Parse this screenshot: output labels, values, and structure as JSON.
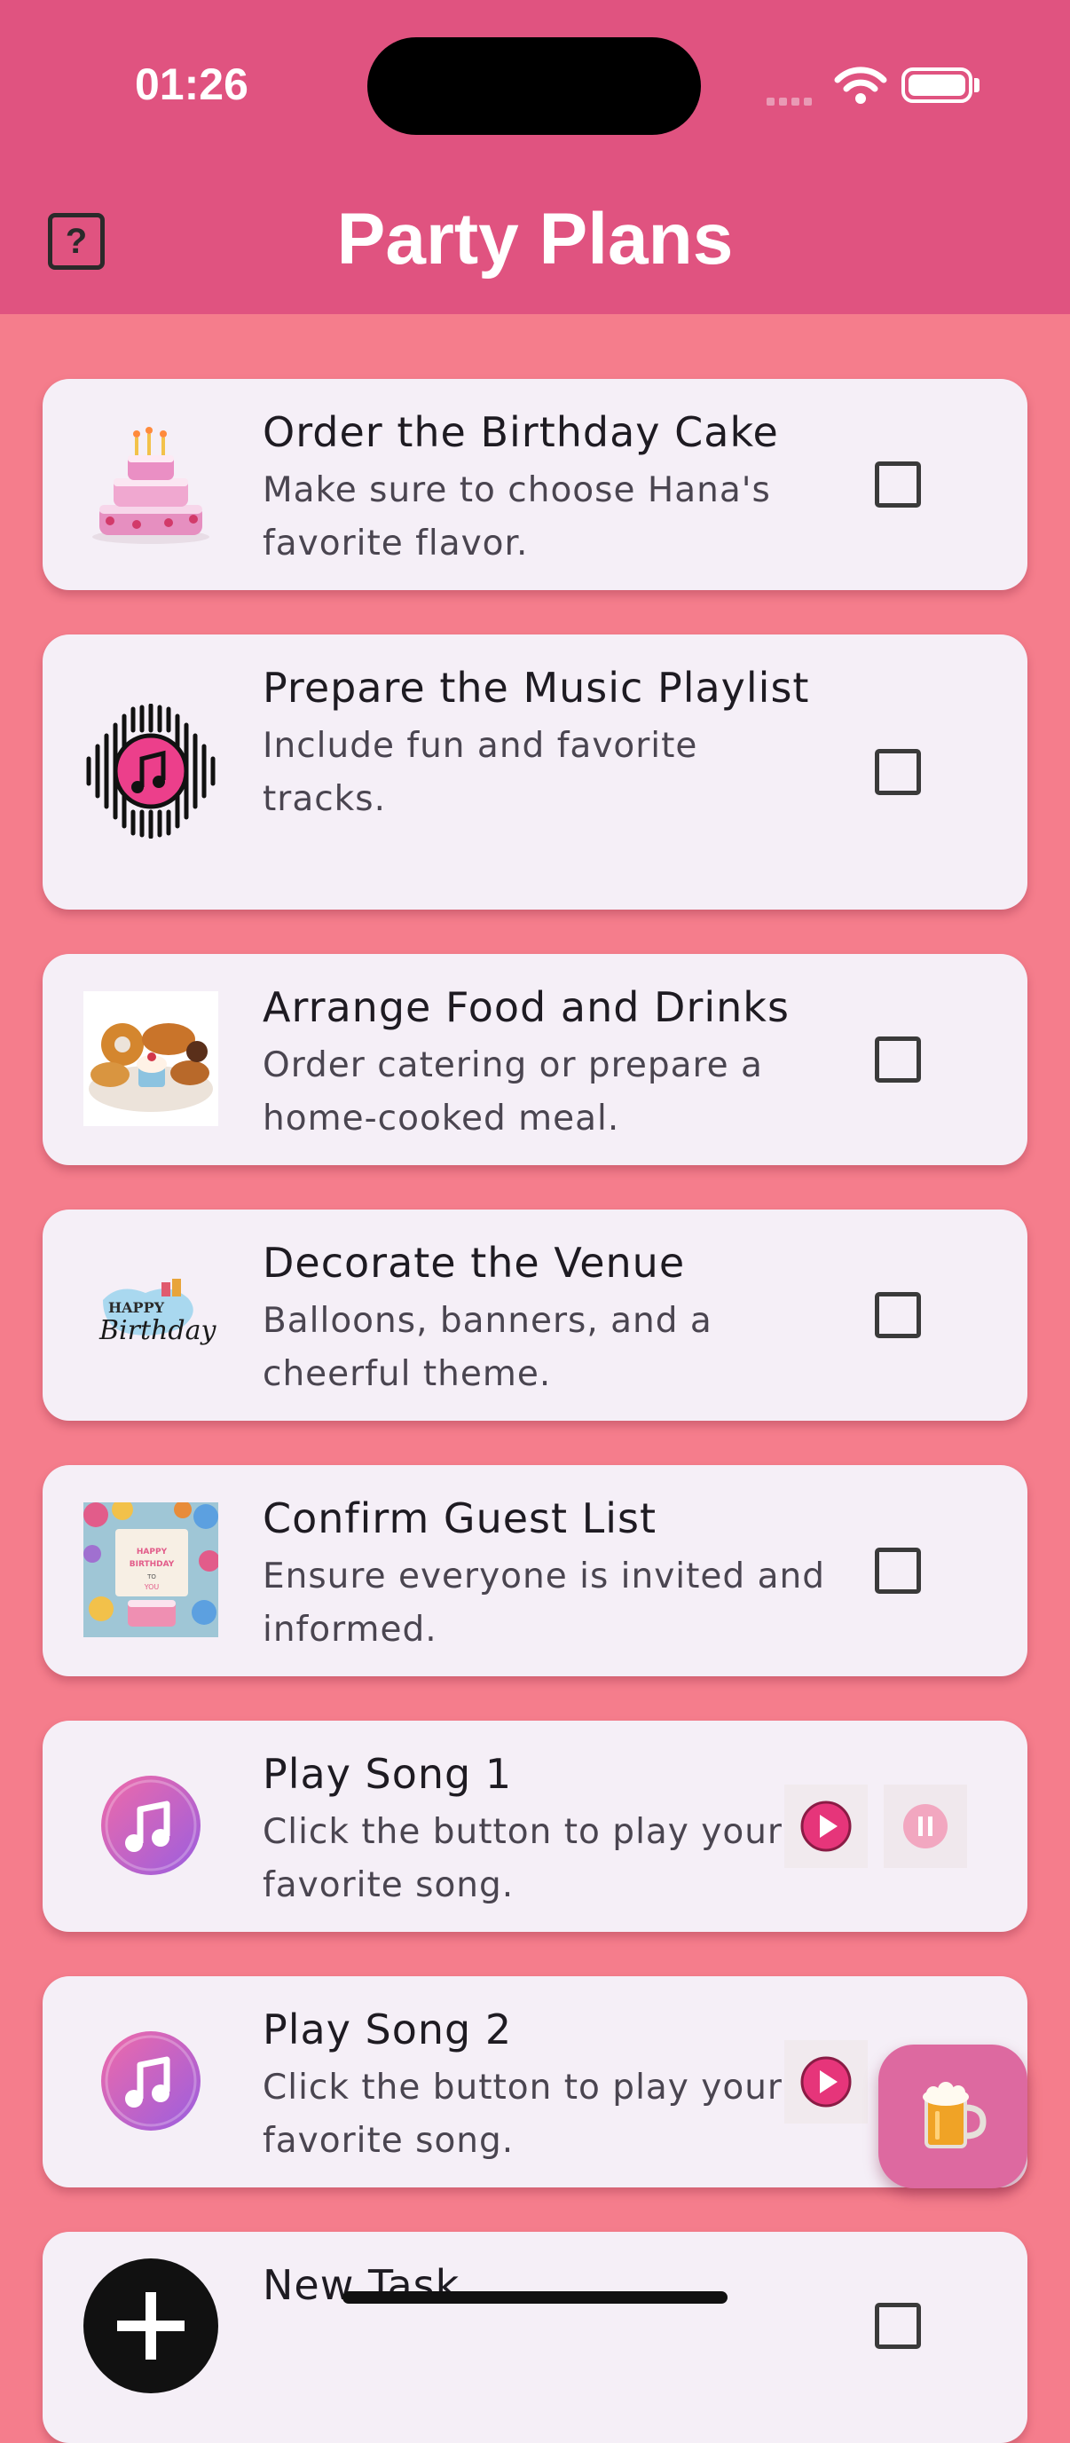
{
  "status_bar": {
    "time": "01:26"
  },
  "app": {
    "title": "Party Plans",
    "help_label": "?"
  },
  "tasks": [
    {
      "title": "Order the Birthday Cake",
      "description": "Make sure to choose Hana's favorite flavor.",
      "icon": "birthday-cake-image",
      "checked": false
    },
    {
      "title": "Prepare the Music Playlist",
      "description": "Include fun and favorite tracks.",
      "icon": "music-note-icon",
      "checked": false
    },
    {
      "title": "Arrange Food and Drinks",
      "description": "Order catering or prepare a home-cooked meal.",
      "icon": "food-platter-image",
      "checked": false
    },
    {
      "title": "Decorate the Venue",
      "description": "Balloons, banners, and a cheerful theme.",
      "icon": "happy-birthday-image",
      "checked": false
    },
    {
      "title": "Confirm Guest List",
      "description": "Ensure everyone is invited and informed.",
      "icon": "invitation-card-image",
      "checked": false
    },
    {
      "title": "New Task",
      "description": "",
      "icon": "plus-icon",
      "checked": false
    }
  ],
  "songs": [
    {
      "title": "Play Song 1",
      "description": "Click the button to play your favorite song.",
      "icon": "music-app-icon"
    },
    {
      "title": "Play Song 2",
      "description": "Click the button to play your favorite song.",
      "icon": "music-app-icon"
    }
  ],
  "colors": {
    "header": "#e05380",
    "background": "#f57d8c",
    "card": "#f5eff7",
    "play": "#e6357a",
    "fab": "#dd69a0"
  }
}
